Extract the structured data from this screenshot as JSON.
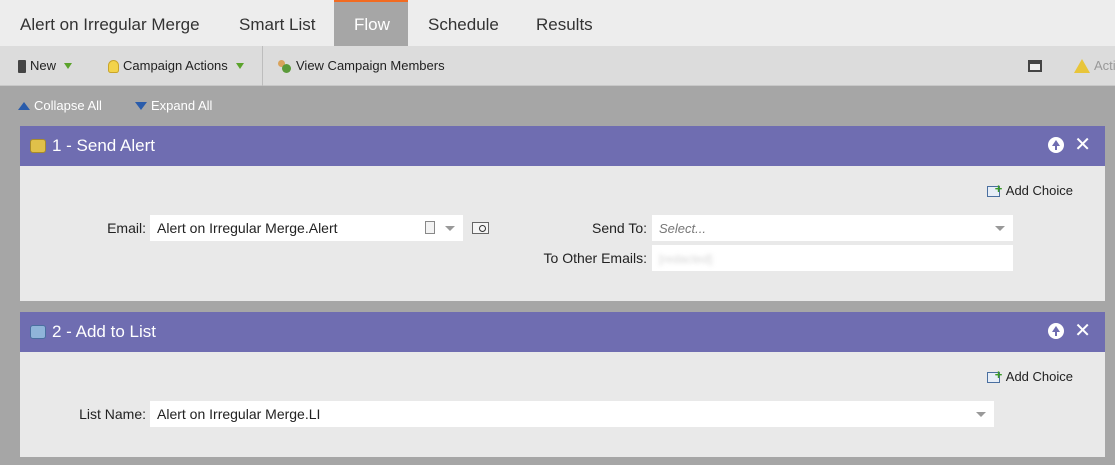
{
  "tabs": [
    {
      "label": "Alert on Irregular Merge",
      "active": false
    },
    {
      "label": "Smart List",
      "active": false
    },
    {
      "label": "Flow",
      "active": true
    },
    {
      "label": "Schedule",
      "active": false
    },
    {
      "label": "Results",
      "active": false
    }
  ],
  "toolbar": {
    "new_label": "New",
    "campaign_actions_label": "Campaign Actions",
    "view_members_label": "View Campaign Members",
    "actions_label": "Acti"
  },
  "subbar": {
    "collapse_label": "Collapse All",
    "expand_label": "Expand All"
  },
  "steps": [
    {
      "title": "1 - Send Alert",
      "add_choice": "Add Choice",
      "email_label": "Email:",
      "email_value": "Alert on Irregular Merge.Alert",
      "send_to_label": "Send To:",
      "send_to_placeholder": "Select...",
      "other_emails_label": "To Other Emails:",
      "other_emails_value": "[redacted]"
    },
    {
      "title": "2 - Add to List",
      "add_choice": "Add Choice",
      "list_label": "List Name:",
      "list_value": "Alert on Irregular Merge.LI"
    }
  ],
  "colors": {
    "accent_tab": "#f26b21",
    "step_header": "#6f6db1"
  }
}
